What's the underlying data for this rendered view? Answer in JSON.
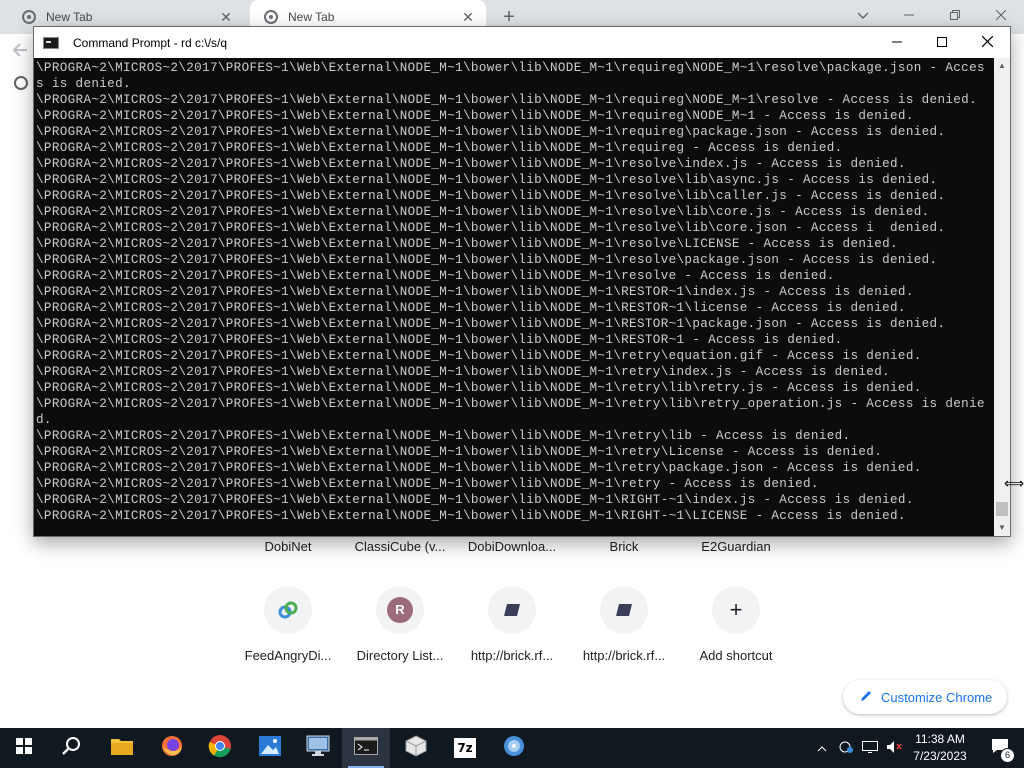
{
  "browser": {
    "tabs": [
      {
        "label": "New Tab",
        "active": false
      },
      {
        "label": "New Tab",
        "active": true
      }
    ],
    "new_tab_symbol": "+",
    "close_symbol": "✕"
  },
  "shortcuts_row1": [
    {
      "label": "DobiNet"
    },
    {
      "label": "ClassiCube (v..."
    },
    {
      "label": "DobiDownloa..."
    },
    {
      "label": "Brick"
    },
    {
      "label": "E2Guardian"
    }
  ],
  "shortcuts_row2": [
    {
      "label": "FeedAngryDi...",
      "icon": "link-icon"
    },
    {
      "label": "Directory List...",
      "icon": "letter-avatar",
      "letter": "R"
    },
    {
      "label": "http://brick.rf...",
      "icon": "brick-icon"
    },
    {
      "label": "http://brick.rf...",
      "icon": "brick-icon"
    },
    {
      "label": "Add shortcut",
      "icon": "plus-icon",
      "symbol": "+"
    }
  ],
  "customize_button": {
    "label": "Customize Chrome"
  },
  "cmd_window": {
    "title": "Command Prompt - rd  c:\\/s/q",
    "lines": [
      "\\PROGRA~2\\MICROS~2\\2017\\PROFES~1\\Web\\External\\NODE_M~1\\bower\\lib\\NODE_M~1\\requireg\\NODE_M~1\\resolve\\package.json - Acces",
      "s is denied.",
      "\\PROGRA~2\\MICROS~2\\2017\\PROFES~1\\Web\\External\\NODE_M~1\\bower\\lib\\NODE_M~1\\requireg\\NODE_M~1\\resolve - Access is denied.",
      "\\PROGRA~2\\MICROS~2\\2017\\PROFES~1\\Web\\External\\NODE_M~1\\bower\\lib\\NODE_M~1\\requireg\\NODE_M~1 - Access is denied.",
      "\\PROGRA~2\\MICROS~2\\2017\\PROFES~1\\Web\\External\\NODE_M~1\\bower\\lib\\NODE_M~1\\requireg\\package.json - Access is denied.",
      "\\PROGRA~2\\MICROS~2\\2017\\PROFES~1\\Web\\External\\NODE_M~1\\bower\\lib\\NODE_M~1\\requireg - Access is denied.",
      "\\PROGRA~2\\MICROS~2\\2017\\PROFES~1\\Web\\External\\NODE_M~1\\bower\\lib\\NODE_M~1\\resolve\\index.js - Access is denied.",
      "\\PROGRA~2\\MICROS~2\\2017\\PROFES~1\\Web\\External\\NODE_M~1\\bower\\lib\\NODE_M~1\\resolve\\lib\\async.js - Access is denied.",
      "\\PROGRA~2\\MICROS~2\\2017\\PROFES~1\\Web\\External\\NODE_M~1\\bower\\lib\\NODE_M~1\\resolve\\lib\\caller.js - Access is denied.",
      "\\PROGRA~2\\MICROS~2\\2017\\PROFES~1\\Web\\External\\NODE_M~1\\bower\\lib\\NODE_M~1\\resolve\\lib\\core.js - Access is denied.",
      "\\PROGRA~2\\MICROS~2\\2017\\PROFES~1\\Web\\External\\NODE_M~1\\bower\\lib\\NODE_M~1\\resolve\\lib\\core.json - Access i  denied.",
      "\\PROGRA~2\\MICROS~2\\2017\\PROFES~1\\Web\\External\\NODE_M~1\\bower\\lib\\NODE_M~1\\resolve\\LICENSE - Access is denied.",
      "\\PROGRA~2\\MICROS~2\\2017\\PROFES~1\\Web\\External\\NODE_M~1\\bower\\lib\\NODE_M~1\\resolve\\package.json - Access is denied.",
      "\\PROGRA~2\\MICROS~2\\2017\\PROFES~1\\Web\\External\\NODE_M~1\\bower\\lib\\NODE_M~1\\resolve - Access is denied.",
      "\\PROGRA~2\\MICROS~2\\2017\\PROFES~1\\Web\\External\\NODE_M~1\\bower\\lib\\NODE_M~1\\RESTOR~1\\index.js - Access is denied.",
      "\\PROGRA~2\\MICROS~2\\2017\\PROFES~1\\Web\\External\\NODE_M~1\\bower\\lib\\NODE_M~1\\RESTOR~1\\license - Access is denied.",
      "\\PROGRA~2\\MICROS~2\\2017\\PROFES~1\\Web\\External\\NODE_M~1\\bower\\lib\\NODE_M~1\\RESTOR~1\\package.json - Access is denied.",
      "\\PROGRA~2\\MICROS~2\\2017\\PROFES~1\\Web\\External\\NODE_M~1\\bower\\lib\\NODE_M~1\\RESTOR~1 - Access is denied.",
      "\\PROGRA~2\\MICROS~2\\2017\\PROFES~1\\Web\\External\\NODE_M~1\\bower\\lib\\NODE_M~1\\retry\\equation.gif - Access is denied.",
      "\\PROGRA~2\\MICROS~2\\2017\\PROFES~1\\Web\\External\\NODE_M~1\\bower\\lib\\NODE_M~1\\retry\\index.js - Access is denied.",
      "\\PROGRA~2\\MICROS~2\\2017\\PROFES~1\\Web\\External\\NODE_M~1\\bower\\lib\\NODE_M~1\\retry\\lib\\retry.js - Access is denied.",
      "\\PROGRA~2\\MICROS~2\\2017\\PROFES~1\\Web\\External\\NODE_M~1\\bower\\lib\\NODE_M~1\\retry\\lib\\retry_operation.js - Access is denie",
      "d.",
      "\\PROGRA~2\\MICROS~2\\2017\\PROFES~1\\Web\\External\\NODE_M~1\\bower\\lib\\NODE_M~1\\retry\\lib - Access is denied.",
      "\\PROGRA~2\\MICROS~2\\2017\\PROFES~1\\Web\\External\\NODE_M~1\\bower\\lib\\NODE_M~1\\retry\\License - Access is denied.",
      "\\PROGRA~2\\MICROS~2\\2017\\PROFES~1\\Web\\External\\NODE_M~1\\bower\\lib\\NODE_M~1\\retry\\package.json - Access is denied.",
      "\\PROGRA~2\\MICROS~2\\2017\\PROFES~1\\Web\\External\\NODE_M~1\\bower\\lib\\NODE_M~1\\retry - Access is denied.",
      "\\PROGRA~2\\MICROS~2\\2017\\PROFES~1\\Web\\External\\NODE_M~1\\bower\\lib\\NODE_M~1\\RIGHT-~1\\index.js - Access is denied.",
      "\\PROGRA~2\\MICROS~2\\2017\\PROFES~1\\Web\\External\\NODE_M~1\\bower\\lib\\NODE_M~1\\RIGHT-~1\\LICENSE - Access is denied."
    ]
  },
  "taskbar": {
    "items": [
      {
        "name": "start-button",
        "icon": "windows-icon"
      },
      {
        "name": "search-button",
        "icon": "search-icon"
      },
      {
        "name": "file-explorer",
        "icon": "folder-icon"
      },
      {
        "name": "firefox",
        "icon": "firefox-icon"
      },
      {
        "name": "chrome",
        "icon": "chrome-icon"
      },
      {
        "name": "photos",
        "icon": "photos-icon"
      },
      {
        "name": "remote-desktop",
        "icon": "monitor-icon"
      },
      {
        "name": "command-prompt",
        "icon": "cmd-icon",
        "active": true
      },
      {
        "name": "package-app",
        "icon": "box-icon"
      },
      {
        "name": "7zip",
        "icon": "7z-icon",
        "label": "7z"
      },
      {
        "name": "disc-app",
        "icon": "disc-icon"
      }
    ],
    "clock": {
      "time": "11:38 AM",
      "date": "7/23/2023"
    },
    "notification_count": "6"
  },
  "colors": {
    "console_bg": "#0c0c0c",
    "console_text": "#cccccc",
    "taskbar_bg": "#101820",
    "accent": "#1a73e8"
  }
}
